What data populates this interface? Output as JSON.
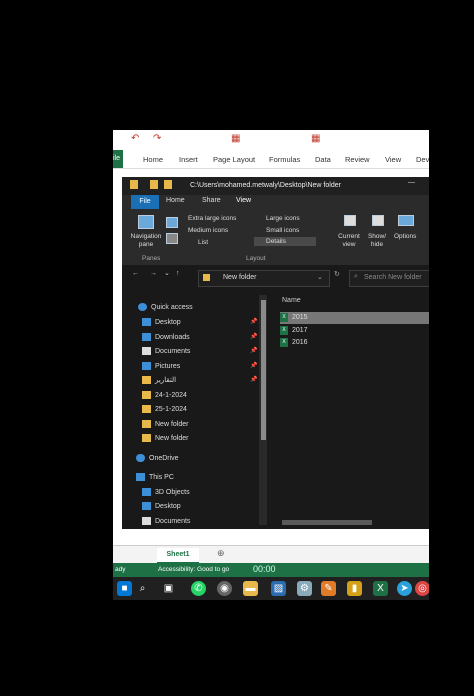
{
  "excel": {
    "file_tab": "ile",
    "ribbon_tabs": [
      "Home",
      "Insert",
      "Page Layout",
      "Formulas",
      "Data",
      "Review",
      "View",
      "Dev"
    ],
    "sheet_tab": "Sheet1",
    "status_left": "ady",
    "status_accessibility": "Accessibility: Good to go",
    "status_time": "00:00"
  },
  "explorer": {
    "path": "C:\\Users\\mohamed.metwaly\\Desktop\\New folder",
    "tabs": [
      "File",
      "Home",
      "Share",
      "View"
    ],
    "ribbon": {
      "navigation_pane": "Navigation pane",
      "layout_options": [
        "Extra large icons",
        "Large icons",
        "Medium icons",
        "Small icons",
        "List",
        "Details"
      ],
      "current_view": "Current view",
      "show_hide": "Show/ hide",
      "options": "Options",
      "panes_label": "Panes",
      "layout_label": "Layout"
    },
    "address": "New folder",
    "search_placeholder": "Search New folder",
    "nav": {
      "quick_access": "Quick access",
      "items": [
        "Desktop",
        "Downloads",
        "Documents",
        "Pictures",
        "التقارير",
        "24-1-2024",
        "25-1-2024",
        "New folder",
        "New folder"
      ],
      "onedrive": "OneDrive",
      "this_pc": "This PC",
      "pc_items": [
        "3D Objects",
        "Desktop",
        "Documents"
      ]
    },
    "column_name": "Name",
    "files": [
      "2015",
      "2017",
      "2016"
    ]
  },
  "colors": {
    "accent": "#1a6fb5",
    "excel_green": "#1e7145",
    "folder": "#e8b84a"
  }
}
